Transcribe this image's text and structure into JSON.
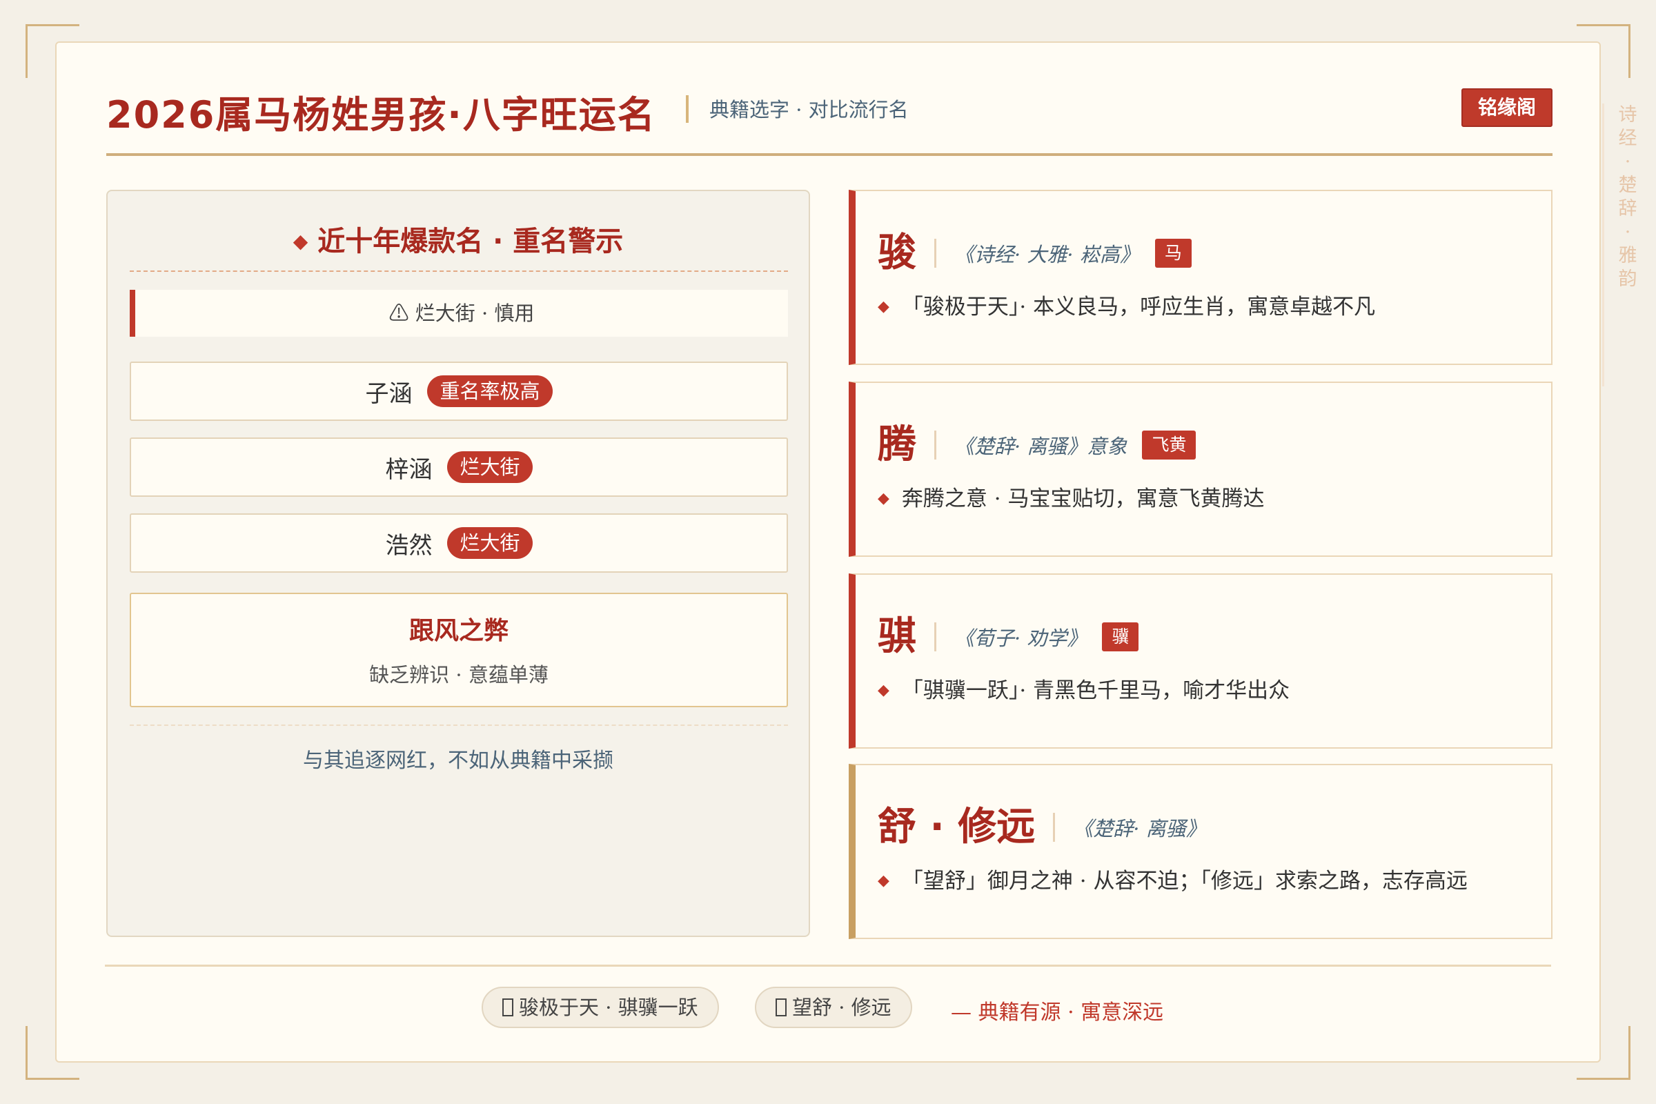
{
  "header": {
    "title": "2026属马杨姓男孩·八字旺运名",
    "subtitle": "典籍选字 · 对比流行名",
    "brand": "铭缘阁"
  },
  "side_text": [
    "诗",
    "经",
    "·",
    "楚",
    "辞",
    "·",
    "雅",
    "韵"
  ],
  "left_panel": {
    "heading": "近十年爆款名 · 重名警示",
    "heading_icon": "diamond-icon",
    "warning": "⚠ 烂大街  ·  慎用",
    "names": [
      {
        "name": "子涵",
        "tag": "重名率极高"
      },
      {
        "name": "梓涵",
        "tag": "烂大街"
      },
      {
        "name": "浩然",
        "tag": "烂大街"
      }
    ],
    "drawback": {
      "title": "跟风之弊",
      "desc": "缺乏辨识 · 意蕴单薄"
    },
    "footer": "与其追逐网红，不如从典籍中采撷"
  },
  "entries": [
    {
      "char": "骏",
      "source": "《诗经· 大雅· 崧高》",
      "tag": "马",
      "desc": "「骏极于天」· 本义良马，呼应生肖，寓意卓越不凡"
    },
    {
      "char": "腾",
      "source": "《楚辞· 离骚》意象",
      "tag": "飞黄",
      "desc": "奔腾之意 · 马宝宝贴切，寓意飞黄腾达"
    },
    {
      "char": "骐",
      "source": "《荀子· 劝学》",
      "tag": "骥",
      "desc": "「骐骥一跃」· 青黑色千里马，喻才华出众"
    },
    {
      "char": "舒 · 修远",
      "source": "《楚辞· 离骚》",
      "tag": "",
      "desc": "「望舒」御月之神 · 从容不迫；「修远」求索之路，志存高远"
    }
  ],
  "footer": {
    "pill1": "骏极于天 · 骐骥一跃",
    "pill2": "望舒 · 修远",
    "motto": "—  典籍有源  ·  寓意深远"
  },
  "colors": {
    "accent_red": "#c0392b",
    "title_red": "#a8291f",
    "gold": "#cfae7c",
    "slate": "#4b6478",
    "background": "#f4f0e7",
    "card": "#fffcf4"
  }
}
